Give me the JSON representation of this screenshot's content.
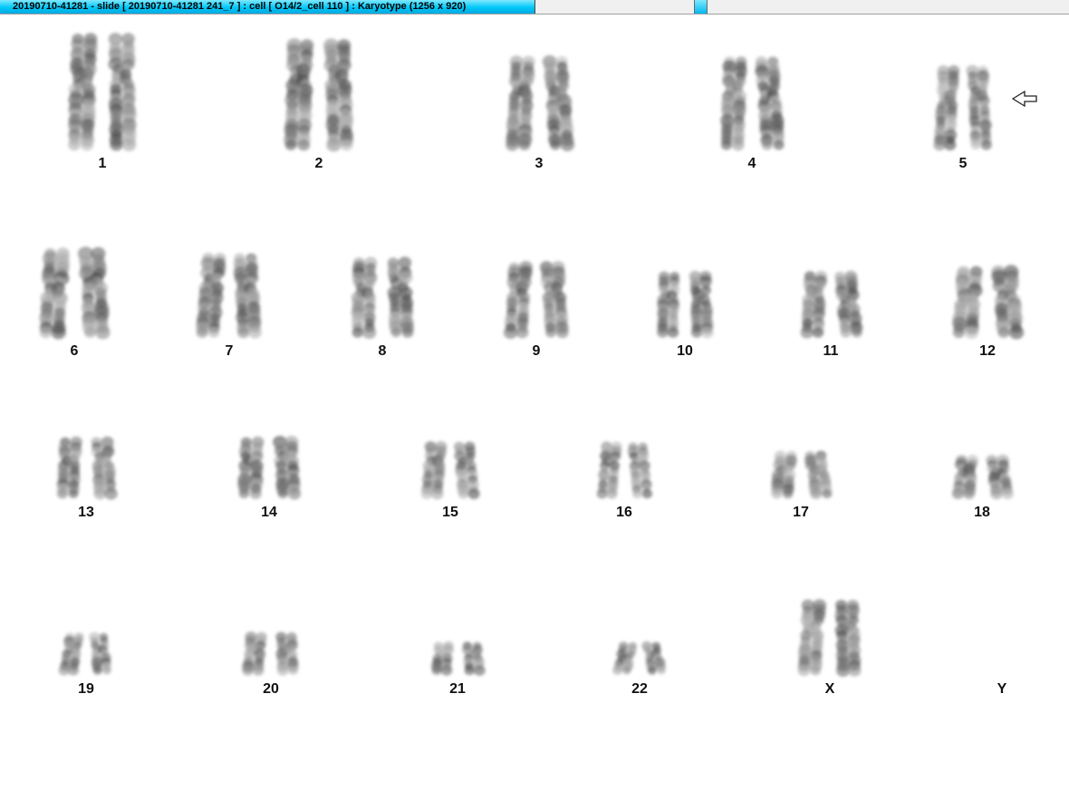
{
  "window": {
    "title": "20190710-41281 - slide [ 20190710-41281 241_7 ] : cell [ O14/2_cell 110 ] : Karyotype  (1256 x 920)"
  },
  "chromosomes": [
    {
      "label": "1"
    },
    {
      "label": "2"
    },
    {
      "label": "3"
    },
    {
      "label": "4"
    },
    {
      "label": "5"
    },
    {
      "label": "6"
    },
    {
      "label": "7"
    },
    {
      "label": "8"
    },
    {
      "label": "9"
    },
    {
      "label": "10"
    },
    {
      "label": "11"
    },
    {
      "label": "12"
    },
    {
      "label": "13"
    },
    {
      "label": "14"
    },
    {
      "label": "15"
    },
    {
      "label": "16"
    },
    {
      "label": "17"
    },
    {
      "label": "18"
    },
    {
      "label": "19"
    },
    {
      "label": "20"
    },
    {
      "label": "21"
    },
    {
      "label": "22"
    },
    {
      "label": "X"
    },
    {
      "label": "Y"
    }
  ],
  "icons": {
    "marker": "hollow-arrow-left-icon"
  }
}
